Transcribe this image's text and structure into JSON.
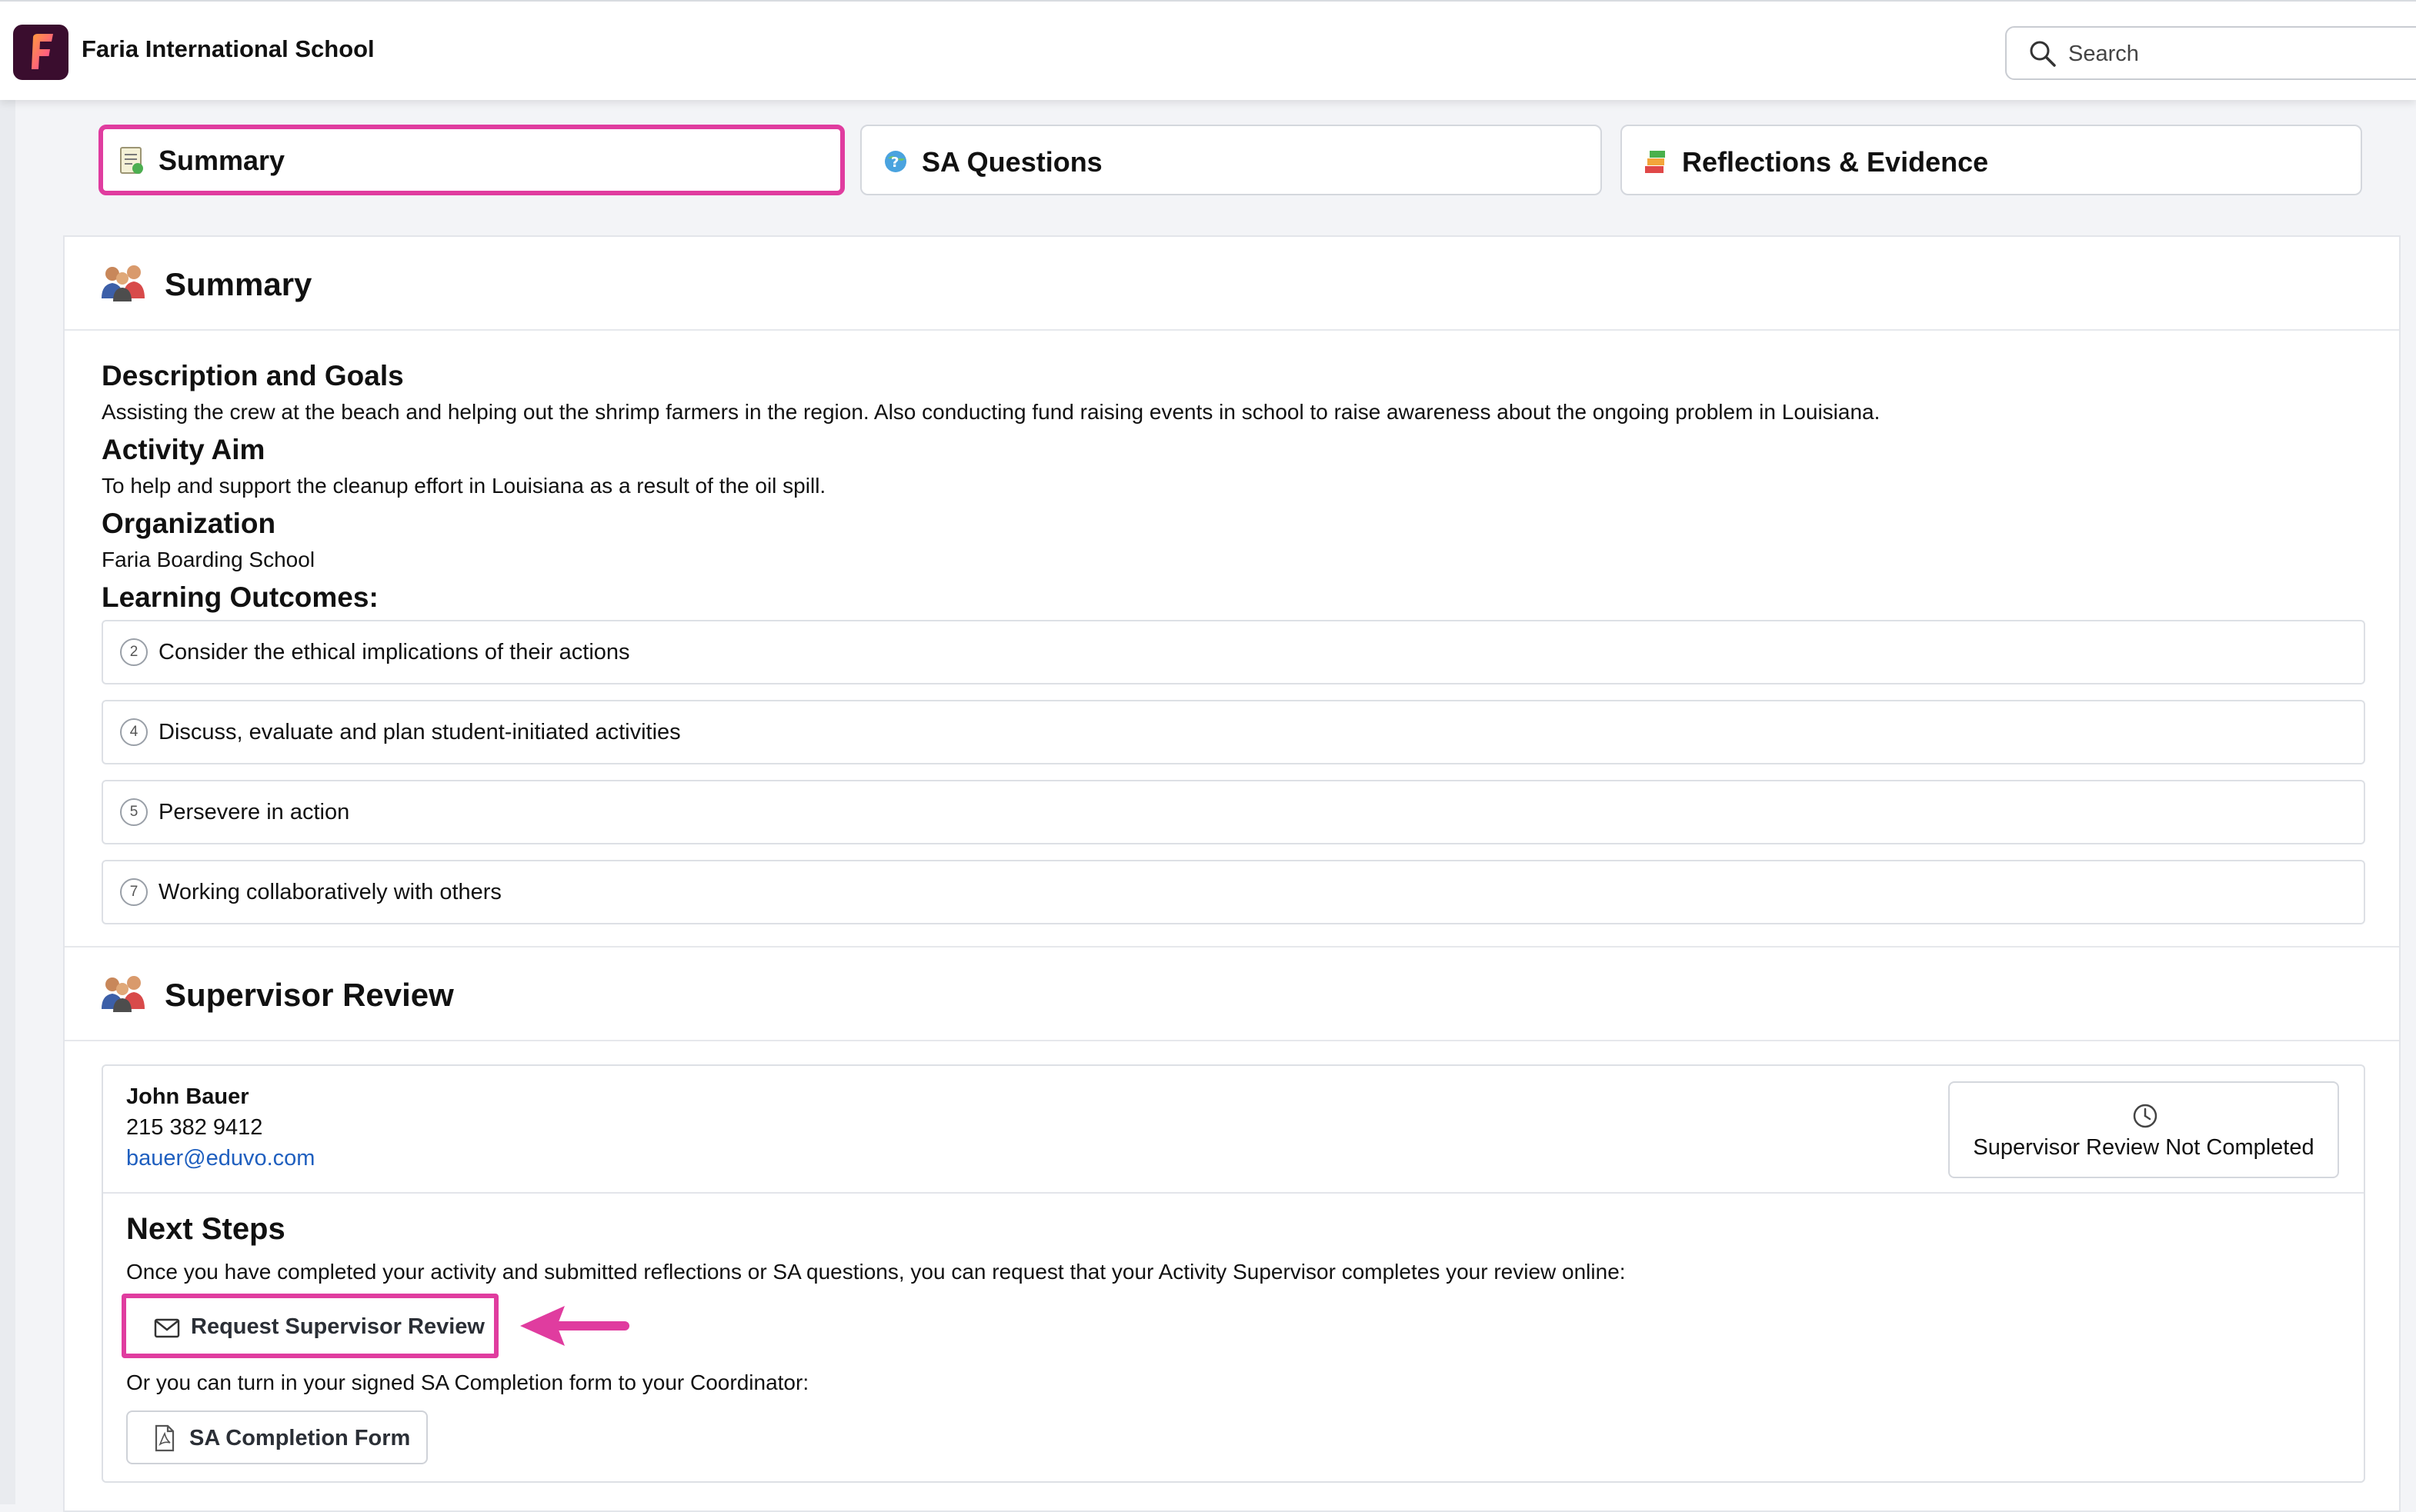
{
  "app": {
    "school_name": "Faria International School",
    "logo_letter": "F",
    "search_placeholder": "Search"
  },
  "tabs": [
    {
      "label": "Summary",
      "icon": "summary-doc-icon",
      "active": true
    },
    {
      "label": "SA Questions",
      "icon": "question-globe-icon",
      "active": false
    },
    {
      "label": "Reflections & Evidence",
      "icon": "reflections-stack-icon",
      "active": false
    }
  ],
  "summary": {
    "title": "Summary",
    "description_heading": "Description and Goals",
    "description_text": "Assisting the crew at the beach and helping out the shrimp farmers in the region. Also conducting fund raising events in school to raise awareness about the ongoing problem in Louisiana.",
    "aim_heading": "Activity Aim",
    "aim_text": "To help and support the cleanup effort in Louisiana as a result of the oil spill.",
    "org_heading": "Organization",
    "org_text": "Faria Boarding School",
    "outcomes_heading": "Learning Outcomes:",
    "outcomes": [
      {
        "num": "2",
        "text": "Consider the ethical implications of their actions"
      },
      {
        "num": "4",
        "text": "Discuss, evaluate and plan student-initiated activities"
      },
      {
        "num": "5",
        "text": "Persevere in action"
      },
      {
        "num": "7",
        "text": "Working collaboratively with others"
      }
    ]
  },
  "supervisor": {
    "title": "Supervisor Review",
    "name": "John Bauer",
    "phone": "215 382 9412",
    "email": "bauer@eduvo.com",
    "status": "Supervisor Review Not Completed",
    "next_steps_heading": "Next Steps",
    "next_steps_text": "Once you have completed your activity and submitted reflections or SA questions, you can request that your Activity Supervisor completes your review online:",
    "request_button": "Request Supervisor Review",
    "alt_text": "Or you can turn in your signed SA Completion form to your Coordinator:",
    "form_button": "SA Completion Form"
  },
  "colors": {
    "highlight": "#e03c9f",
    "link": "#1f5fbf",
    "logo_bg": "#3a0d2e"
  }
}
